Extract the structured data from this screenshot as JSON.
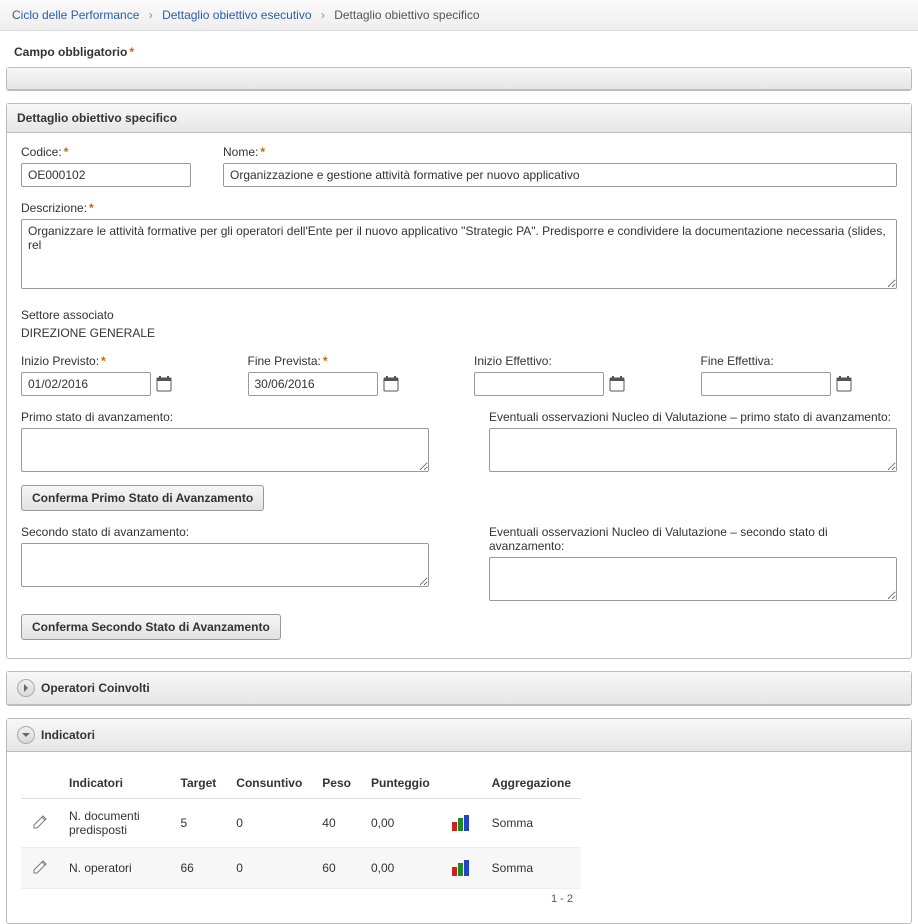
{
  "breadcrumb": {
    "items": [
      {
        "label": "Ciclo delle Performance",
        "link": true
      },
      {
        "label": "Dettaglio obiettivo esecutivo",
        "link": true
      },
      {
        "label": "Dettaglio obiettivo specifico",
        "link": false
      }
    ]
  },
  "required_hint": "Campo obbligatorio",
  "section_campo": {
    "title": ""
  },
  "section_detail": {
    "title": "Dettaglio obiettivo specifico",
    "codice_label": "Codice:",
    "codice_value": "OE000102",
    "nome_label": "Nome:",
    "nome_value": "Organizzazione e gestione attività formative per nuovo applicativo",
    "descrizione_label": "Descrizione:",
    "descrizione_value": "Organizzare le attività formative per gli operatori dell'Ente per il nuovo applicativo \"Strategic PA\". Predisporre e condividere la documentazione necessaria (slides, rel",
    "settore_label": "Settore associato",
    "settore_value": "DIREZIONE GENERALE",
    "inizio_prev_label": "Inizio Previsto:",
    "inizio_prev_value": "01/02/2016",
    "fine_prev_label": "Fine Prevista:",
    "fine_prev_value": "30/06/2016",
    "inizio_eff_label": "Inizio Effettivo:",
    "inizio_eff_value": "",
    "fine_eff_label": "Fine Effettiva:",
    "fine_eff_value": "",
    "primo_stato_label": "Primo stato di avanzamento:",
    "primo_stato_value": "",
    "oss_primo_label": "Eventuali osservazioni Nucleo di Valutazione – primo stato di avanzamento:",
    "oss_primo_value": "",
    "btn_conferma_primo": "Conferma Primo Stato di Avanzamento",
    "secondo_stato_label": "Secondo stato di avanzamento:",
    "secondo_stato_value": "",
    "oss_secondo_label": "Eventuali osservazioni Nucleo di Valutazione – secondo stato di avanzamento:",
    "oss_secondo_value": "",
    "btn_conferma_secondo": "Conferma Secondo Stato di Avanzamento"
  },
  "section_operatori": {
    "title": "Operatori Coinvolti"
  },
  "section_indicatori": {
    "title": "Indicatori",
    "columns": {
      "indicatori": "Indicatori",
      "target": "Target",
      "consuntivo": "Consuntivo",
      "peso": "Peso",
      "punteggio": "Punteggio",
      "aggregazione": "Aggregazione"
    },
    "rows": [
      {
        "name": "N. documenti predisposti",
        "target": "5",
        "consuntivo": "0",
        "peso": "40",
        "punteggio": "0,00",
        "aggregazione": "Somma"
      },
      {
        "name": "N. operatori",
        "target": "66",
        "consuntivo": "0",
        "peso": "60",
        "punteggio": "0,00",
        "aggregazione": "Somma"
      }
    ],
    "pager": "1 - 2"
  }
}
